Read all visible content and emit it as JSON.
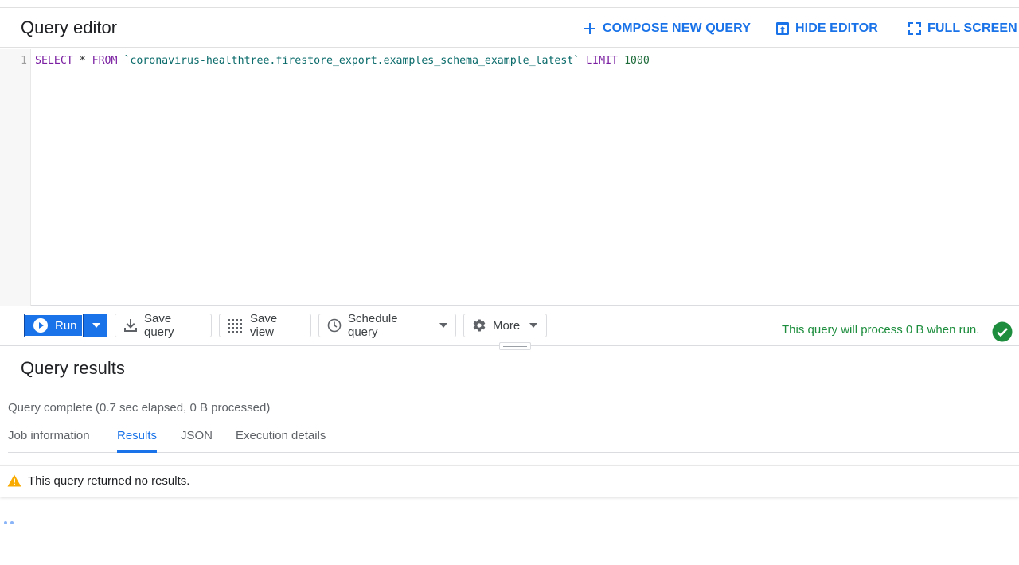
{
  "header": {
    "title": "Query editor",
    "compose_label": "COMPOSE NEW QUERY",
    "hide_editor_label": "HIDE EDITOR",
    "full_screen_label": "FULL SCREEN"
  },
  "editor": {
    "line_number": "1",
    "code": {
      "select": "SELECT",
      "star": "*",
      "from": "FROM",
      "table": "`coronavirus-healthtree.firestore_export.examples_schema_example_latest`",
      "limit": "LIMIT",
      "limit_value": "1000"
    }
  },
  "toolbar": {
    "run_label": "Run",
    "save_query_label": "Save query",
    "save_view_label": "Save view",
    "schedule_label": "Schedule query",
    "more_label": "More",
    "validator_text": "This query will process 0 B when run."
  },
  "results": {
    "title": "Query results",
    "status": "Query complete (0.7 sec elapsed, 0 B processed)",
    "tabs": [
      {
        "label": "Job information"
      },
      {
        "label": "Results"
      },
      {
        "label": "JSON"
      },
      {
        "label": "Execution details"
      }
    ],
    "active_tab": "Results",
    "message": "This query returned no results."
  },
  "colors": {
    "accent": "#1a73e8",
    "success": "#1e8e3e",
    "warning": "#f9ab00"
  }
}
